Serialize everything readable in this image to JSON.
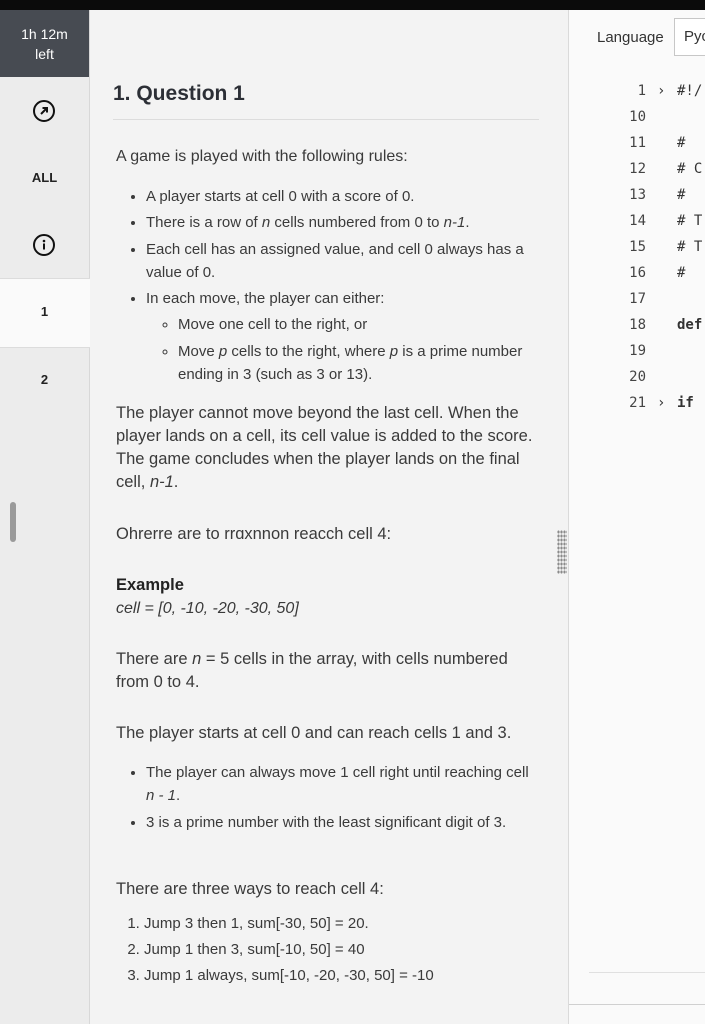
{
  "timer": {
    "line1": "1h 12m",
    "line2": "left"
  },
  "sidebar": {
    "all_label": "ALL",
    "questions": [
      "1",
      "2"
    ]
  },
  "question": {
    "title": "1. Question 1",
    "intro": "A game is played with the following rules:",
    "rules": [
      "A player starts at cell 0 with a score of 0.",
      "Each cell has an assigned value, and cell 0 always has a value of 0.",
      "In each move, the player can either:"
    ],
    "rule_row": {
      "prefix": "There is a row of ",
      "n": "n",
      "middle": " cells numbered from 0 to ",
      "n_minus_1": "n-1",
      "suffix": "."
    },
    "move_options": {
      "right": "Move one cell to the right, or",
      "p_prefix": "Move ",
      "p": "p",
      "p_middle": " cells to the right, where ",
      "p_suffix": " is a prime number ending in 3 (such as 3 or 13)."
    },
    "para1_text": "The player cannot move beyond the last cell. When the player lands on a cell, its cell value is added to the score. The game concludes when the player lands on the final cell, ",
    "para1_tail": ".",
    "para2": "Ohrerre are to rrɑxnnon reacch cell 4:",
    "example_title": "Example",
    "example_array": "cell = [0, -10, -20, -30, 50]",
    "para3": {
      "prefix": "There are ",
      "n_eq": "n",
      "middle": " = 5 cells in the array, with cells numbered from 0 to 4."
    },
    "para4": "The player starts at cell 0 and can reach cells 1 and 3.",
    "reach_bullets": {
      "first_prefix": "The player can always move 1 cell right until reaching cell ",
      "first_expr": "n - 1",
      "first_suffix": ".",
      "second": "3 is a prime number with the least significant digit of 3."
    },
    "ways_intro": "There are three ways to reach cell 4:",
    "ways": [
      "Jump 3 then 1, sum[-30, 50] = 20.",
      "Jump 1 then 3, sum[-10, 50] = 40",
      "Jump 1 always, sum[-10, -20, -30, 50] = -10"
    ]
  },
  "editor": {
    "language_label": "Language",
    "language_value": "Pyc",
    "lines": [
      {
        "num": "1",
        "fold": "›",
        "code": "#!/"
      },
      {
        "num": "10",
        "fold": "",
        "code": ""
      },
      {
        "num": "11",
        "fold": "",
        "code": "#"
      },
      {
        "num": "12",
        "fold": "",
        "code": "# C"
      },
      {
        "num": "13",
        "fold": "",
        "code": "#"
      },
      {
        "num": "14",
        "fold": "",
        "code": "# T"
      },
      {
        "num": "15",
        "fold": "",
        "code": "# T"
      },
      {
        "num": "16",
        "fold": "",
        "code": "#"
      },
      {
        "num": "17",
        "fold": "",
        "code": ""
      },
      {
        "num": "18",
        "fold": "",
        "code": "def"
      },
      {
        "num": "19",
        "fold": "",
        "code": ""
      },
      {
        "num": "20",
        "fold": "",
        "code": ""
      },
      {
        "num": "21",
        "fold": "›",
        "code": "if"
      }
    ]
  }
}
